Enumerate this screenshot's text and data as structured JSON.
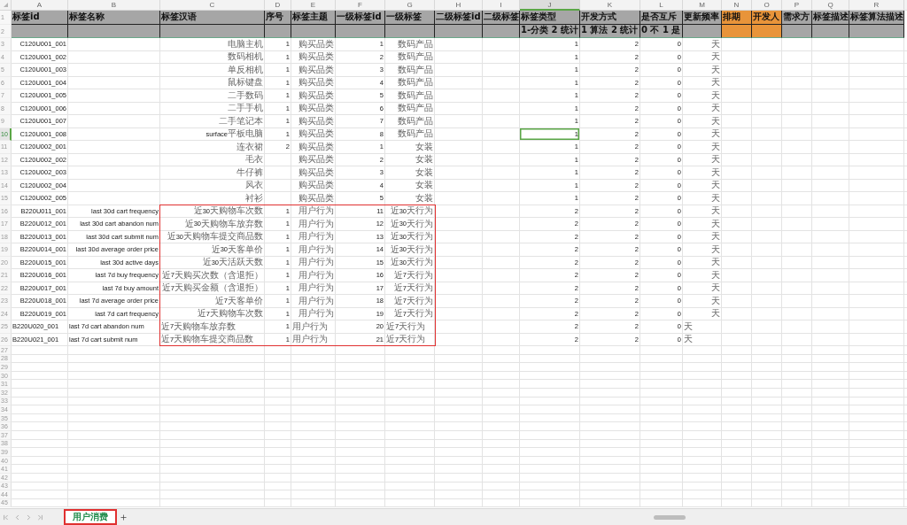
{
  "columns": [
    {
      "letter": "A",
      "kind": "text",
      "color": "#a6a6a6",
      "selected": false
    },
    {
      "letter": "B",
      "kind": "text",
      "color": "#a6a6a6",
      "selected": false
    },
    {
      "letter": "C",
      "kind": "text",
      "color": "#a6a6a6",
      "selected": false
    },
    {
      "letter": "D",
      "kind": "number",
      "color": "#a6a6a6",
      "selected": false
    },
    {
      "letter": "E",
      "kind": "text",
      "color": "#a6a6a6",
      "selected": false
    },
    {
      "letter": "F",
      "kind": "number",
      "color": "#a6a6a6",
      "selected": false
    },
    {
      "letter": "G",
      "kind": "text",
      "color": "#a6a6a6",
      "selected": false
    },
    {
      "letter": "H",
      "kind": "text",
      "color": "#a6a6a6",
      "selected": false
    },
    {
      "letter": "I",
      "kind": "text",
      "color": "#a6a6a6",
      "selected": false
    },
    {
      "letter": "J",
      "kind": "number",
      "color": "#a6a6a6",
      "selected": true
    },
    {
      "letter": "K",
      "kind": "number",
      "color": "#a6a6a6",
      "selected": false
    },
    {
      "letter": "L",
      "kind": "number",
      "color": "#a6a6a6",
      "selected": false
    },
    {
      "letter": "M",
      "kind": "text",
      "color": "#a6a6a6",
      "selected": false
    },
    {
      "letter": "N",
      "kind": "text",
      "color": "#e8943a",
      "selected": false
    },
    {
      "letter": "O",
      "kind": "text",
      "color": "#e8943a",
      "selected": false
    },
    {
      "letter": "P",
      "kind": "text",
      "color": "#a6a6a6",
      "selected": false
    },
    {
      "letter": "Q",
      "kind": "text",
      "color": "#a6a6a6",
      "selected": false
    },
    {
      "letter": "R",
      "kind": "text",
      "color": "#a6a6a6",
      "selected": false
    }
  ],
  "header_rows": [
    {
      "number": "1",
      "cells": [
        "标签id",
        "标签名称",
        "标签汉语",
        "序号",
        "标签主题",
        "一级标签id",
        "一级标签",
        "二级标签id",
        "二级标签",
        "标签类型",
        "开发方式",
        "是否互斥",
        "更新频率",
        "排期",
        "开发人",
        "需求方",
        "标签描述",
        "标签算法描述"
      ]
    },
    {
      "number": "2",
      "cells": [
        null,
        null,
        null,
        null,
        null,
        null,
        null,
        null,
        null,
        "1-分类 2 统计",
        "1 算法 2 统计",
        "0 不 1 是",
        null,
        null,
        null,
        null,
        null,
        null
      ]
    }
  ],
  "rows": [
    {
      "number": "3",
      "kind": "standard",
      "selected": false,
      "cells": [
        "C120U001_001",
        null,
        "电脑主机",
        "1",
        "购买品类",
        "1",
        "数码产品",
        null,
        null,
        "1",
        "2",
        "0",
        "天",
        null,
        null,
        null,
        null,
        null
      ]
    },
    {
      "number": "4",
      "kind": "standard",
      "selected": false,
      "cells": [
        "C120U001_002",
        null,
        "数码相机",
        "1",
        "购买品类",
        "2",
        "数码产品",
        null,
        null,
        "1",
        "2",
        "0",
        "天",
        null,
        null,
        null,
        null,
        null
      ]
    },
    {
      "number": "5",
      "kind": "standard",
      "selected": false,
      "cells": [
        "C120U001_003",
        null,
        "单反相机",
        "1",
        "购买品类",
        "3",
        "数码产品",
        null,
        null,
        "1",
        "2",
        "0",
        "天",
        null,
        null,
        null,
        null,
        null
      ]
    },
    {
      "number": "6",
      "kind": "standard",
      "selected": false,
      "cells": [
        "C120U001_004",
        null,
        "鼠标键盘",
        "1",
        "购买品类",
        "4",
        "数码产品",
        null,
        null,
        "1",
        "2",
        "0",
        "天",
        null,
        null,
        null,
        null,
        null
      ]
    },
    {
      "number": "7",
      "kind": "standard",
      "selected": false,
      "cells": [
        "C120U001_005",
        null,
        "二手数码",
        "1",
        "购买品类",
        "5",
        "数码产品",
        null,
        null,
        "1",
        "2",
        "0",
        "天",
        null,
        null,
        null,
        null,
        null
      ]
    },
    {
      "number": "8",
      "kind": "standard",
      "selected": false,
      "cells": [
        "C120U001_006",
        null,
        "二手手机",
        "1",
        "购买品类",
        "6",
        "数码产品",
        null,
        null,
        "1",
        "2",
        "0",
        "天",
        null,
        null,
        null,
        null,
        null
      ]
    },
    {
      "number": "9",
      "kind": "standard",
      "selected": false,
      "cells": [
        "C120U001_007",
        null,
        "二手笔记本",
        "1",
        "购买品类",
        "7",
        "数码产品",
        null,
        null,
        "1",
        "2",
        "0",
        "天",
        null,
        null,
        null,
        null,
        null
      ]
    },
    {
      "number": "10",
      "kind": "standard",
      "selected": true,
      "cells": [
        "C120U001_008",
        null,
        "surface平板电脑",
        "1",
        "购买品类",
        "8",
        "数码产品",
        null,
        null,
        "1",
        "2",
        "0",
        "天",
        null,
        null,
        null,
        null,
        null
      ]
    },
    {
      "number": "11",
      "kind": "standard",
      "selected": false,
      "cells": [
        "C120U002_001",
        null,
        "连衣裙",
        "2",
        "购买品类",
        "1",
        "女装",
        null,
        null,
        "1",
        "2",
        "0",
        "天",
        null,
        null,
        null,
        null,
        null
      ]
    },
    {
      "number": "12",
      "kind": "standard",
      "selected": false,
      "cells": [
        "C120U002_002",
        null,
        "毛衣",
        null,
        "购买品类",
        "2",
        "女装",
        null,
        null,
        "1",
        "2",
        "0",
        "天",
        null,
        null,
        null,
        null,
        null
      ]
    },
    {
      "number": "13",
      "kind": "standard",
      "selected": false,
      "cells": [
        "C120U002_003",
        null,
        "牛仔裤",
        null,
        "购买品类",
        "3",
        "女装",
        null,
        null,
        "1",
        "2",
        "0",
        "天",
        null,
        null,
        null,
        null,
        null
      ]
    },
    {
      "number": "14",
      "kind": "standard",
      "selected": false,
      "cells": [
        "C120U002_004",
        null,
        "风衣",
        null,
        "购买品类",
        "4",
        "女装",
        null,
        null,
        "1",
        "2",
        "0",
        "天",
        null,
        null,
        null,
        null,
        null
      ]
    },
    {
      "number": "15",
      "kind": "standard",
      "selected": false,
      "cells": [
        "C120U002_005",
        null,
        "衬衫",
        null,
        "购买品类",
        "5",
        "女装",
        null,
        null,
        "1",
        "2",
        "0",
        "天",
        null,
        null,
        null,
        null,
        null
      ]
    },
    {
      "number": "16",
      "kind": "standard",
      "selected": false,
      "cells": [
        "B220U011_001",
        "last 30d cart frequency",
        "近30天购物车次数",
        "1",
        "用户行为",
        "11",
        "近30天行为",
        null,
        null,
        "2",
        "2",
        "0",
        "天",
        null,
        null,
        null,
        null,
        null
      ]
    },
    {
      "number": "17",
      "kind": "standard",
      "selected": false,
      "cells": [
        "B220U012_001",
        "last 30d cart abandon num",
        "近30天购物车放弃数",
        "1",
        "用户行为",
        "12",
        "近30天行为",
        null,
        null,
        "2",
        "2",
        "0",
        "天",
        null,
        null,
        null,
        null,
        null
      ]
    },
    {
      "number": "18",
      "kind": "standard",
      "selected": false,
      "cells": [
        "B220U013_001",
        "last 30d cart submit num",
        "近30天购物车提交商品数",
        "1",
        "用户行为",
        "13",
        "近30天行为",
        null,
        null,
        "2",
        "2",
        "0",
        "天",
        null,
        null,
        null,
        null,
        null
      ]
    },
    {
      "number": "19",
      "kind": "standard",
      "selected": false,
      "cells": [
        "B220U014_001",
        "last 30d average order price",
        "近30天客单价",
        "1",
        "用户行为",
        "14",
        "近30天行为",
        null,
        null,
        "2",
        "2",
        "0",
        "天",
        null,
        null,
        null,
        null,
        null
      ]
    },
    {
      "number": "20",
      "kind": "standard",
      "selected": false,
      "cells": [
        "B220U015_001",
        "last 30d active days",
        "近30天活跃天数",
        "1",
        "用户行为",
        "15",
        "近30天行为",
        null,
        null,
        "2",
        "2",
        "0",
        "天",
        null,
        null,
        null,
        null,
        null
      ]
    },
    {
      "number": "21",
      "kind": "standard",
      "selected": false,
      "cells": [
        "B220U016_001",
        "last 7d buy frequency",
        "近7天购买次数（含退拒）",
        "1",
        "用户行为",
        "16",
        "近7天行为",
        null,
        null,
        "2",
        "2",
        "0",
        "天",
        null,
        null,
        null,
        null,
        null
      ]
    },
    {
      "number": "22",
      "kind": "standard",
      "selected": false,
      "cells": [
        "B220U017_001",
        "last 7d buy amount",
        "近7天购买金额（含退拒）",
        "1",
        "用户行为",
        "17",
        "近7天行为",
        null,
        null,
        "2",
        "2",
        "0",
        "天",
        null,
        null,
        null,
        null,
        null
      ]
    },
    {
      "number": "23",
      "kind": "standard",
      "selected": false,
      "cells": [
        "B220U018_001",
        "last 7d average order price",
        "近7天客单价",
        "1",
        "用户行为",
        "18",
        "近7天行为",
        null,
        null,
        "2",
        "2",
        "0",
        "天",
        null,
        null,
        null,
        null,
        null
      ]
    },
    {
      "number": "24",
      "kind": "standard",
      "selected": false,
      "cells": [
        "B220U019_001",
        "last 7d cart frequency",
        "近7天购物车次数",
        "1",
        "用户行为",
        "19",
        "近7天行为",
        null,
        null,
        "2",
        "2",
        "0",
        "天",
        null,
        null,
        null,
        null,
        null
      ]
    },
    {
      "number": "25",
      "kind": "plain",
      "selected": false,
      "cells": [
        "B220U020_001",
        "last 7d cart abandon num",
        "近7天购物车放弃数",
        "1",
        "用户行为",
        "20",
        "近7天行为",
        null,
        null,
        "2",
        "2",
        "0",
        "天",
        null,
        null,
        null,
        null,
        null
      ]
    },
    {
      "number": "26",
      "kind": "plain",
      "selected": false,
      "cells": [
        "B220U021_001",
        "last 7d cart submit num",
        "近7天购物车提交商品数",
        "1",
        "用户行为",
        "21",
        "近7天行为",
        null,
        null,
        "2",
        "2",
        "0",
        "天",
        null,
        null,
        null,
        null,
        null
      ]
    },
    {
      "number": "27",
      "selected": false
    },
    {
      "number": "28",
      "selected": false
    },
    {
      "number": "29",
      "selected": false
    },
    {
      "number": "30",
      "selected": false
    },
    {
      "number": "31",
      "selected": false
    },
    {
      "number": "32",
      "selected": false
    },
    {
      "number": "33",
      "selected": false
    },
    {
      "number": "34",
      "selected": false
    },
    {
      "number": "35",
      "selected": false
    },
    {
      "number": "36",
      "selected": false
    },
    {
      "number": "37",
      "selected": false
    },
    {
      "number": "38",
      "selected": false
    },
    {
      "number": "39",
      "selected": false
    },
    {
      "number": "40",
      "selected": false
    },
    {
      "number": "41",
      "selected": false
    },
    {
      "number": "42",
      "selected": false
    },
    {
      "number": "43",
      "selected": false
    },
    {
      "number": "44",
      "selected": false
    },
    {
      "number": "45",
      "selected": false
    }
  ],
  "annotations": [
    {
      "kind": "cell-range-box"
    }
  ],
  "sheet_tabs": [
    {
      "label": "用户消费",
      "selected": true,
      "outlined": true
    }
  ]
}
